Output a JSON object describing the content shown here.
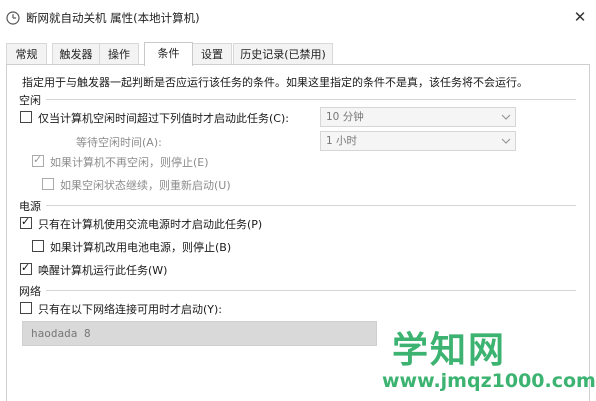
{
  "window": {
    "title": "断网就自动关机 属性(本地计算机)",
    "close_glyph": "✕"
  },
  "tabs": [
    {
      "label": "常规",
      "active": false
    },
    {
      "label": "触发器",
      "active": false
    },
    {
      "label": "操作",
      "active": false
    },
    {
      "label": "条件",
      "active": true
    },
    {
      "label": "设置",
      "active": false
    },
    {
      "label": "历史记录(已禁用)",
      "active": false
    }
  ],
  "conditions": {
    "description": "指定用于与触发器一起判断是否应运行该任务的条件。如果这里指定的条件不是真，该任务将不会运行。",
    "idle": {
      "group_label": "空闲",
      "start_only_if_idle": {
        "label": "仅当计算机空闲时间超过下列值时才启动此任务(C):",
        "checked": false
      },
      "idle_duration": "10 分钟",
      "wait_label": "等待空闲时间(A):",
      "wait_duration": "1 小时",
      "stop_if_not_idle": {
        "label": "如果计算机不再空闲，则停止(E)",
        "checked": true
      },
      "restart_if_idle": {
        "label": "如果空闲状态继续，则重新启动(U)",
        "checked": false
      }
    },
    "power": {
      "group_label": "电源",
      "ac_only": {
        "label": "只有在计算机使用交流电源时才启动此任务(P)",
        "checked": true
      },
      "stop_on_battery": {
        "label": "如果计算机改用电池电源，则停止(B)",
        "checked": false
      },
      "wake": {
        "label": "唤醒计算机运行此任务(W)",
        "checked": true
      }
    },
    "network": {
      "group_label": "网络",
      "network_only": {
        "label": "只有在以下网络连接可用时才启动(Y):",
        "checked": false
      },
      "network_name": "haodada 8"
    }
  },
  "watermark": {
    "text": "学知网",
    "url": "www.jmqz1000.com"
  }
}
